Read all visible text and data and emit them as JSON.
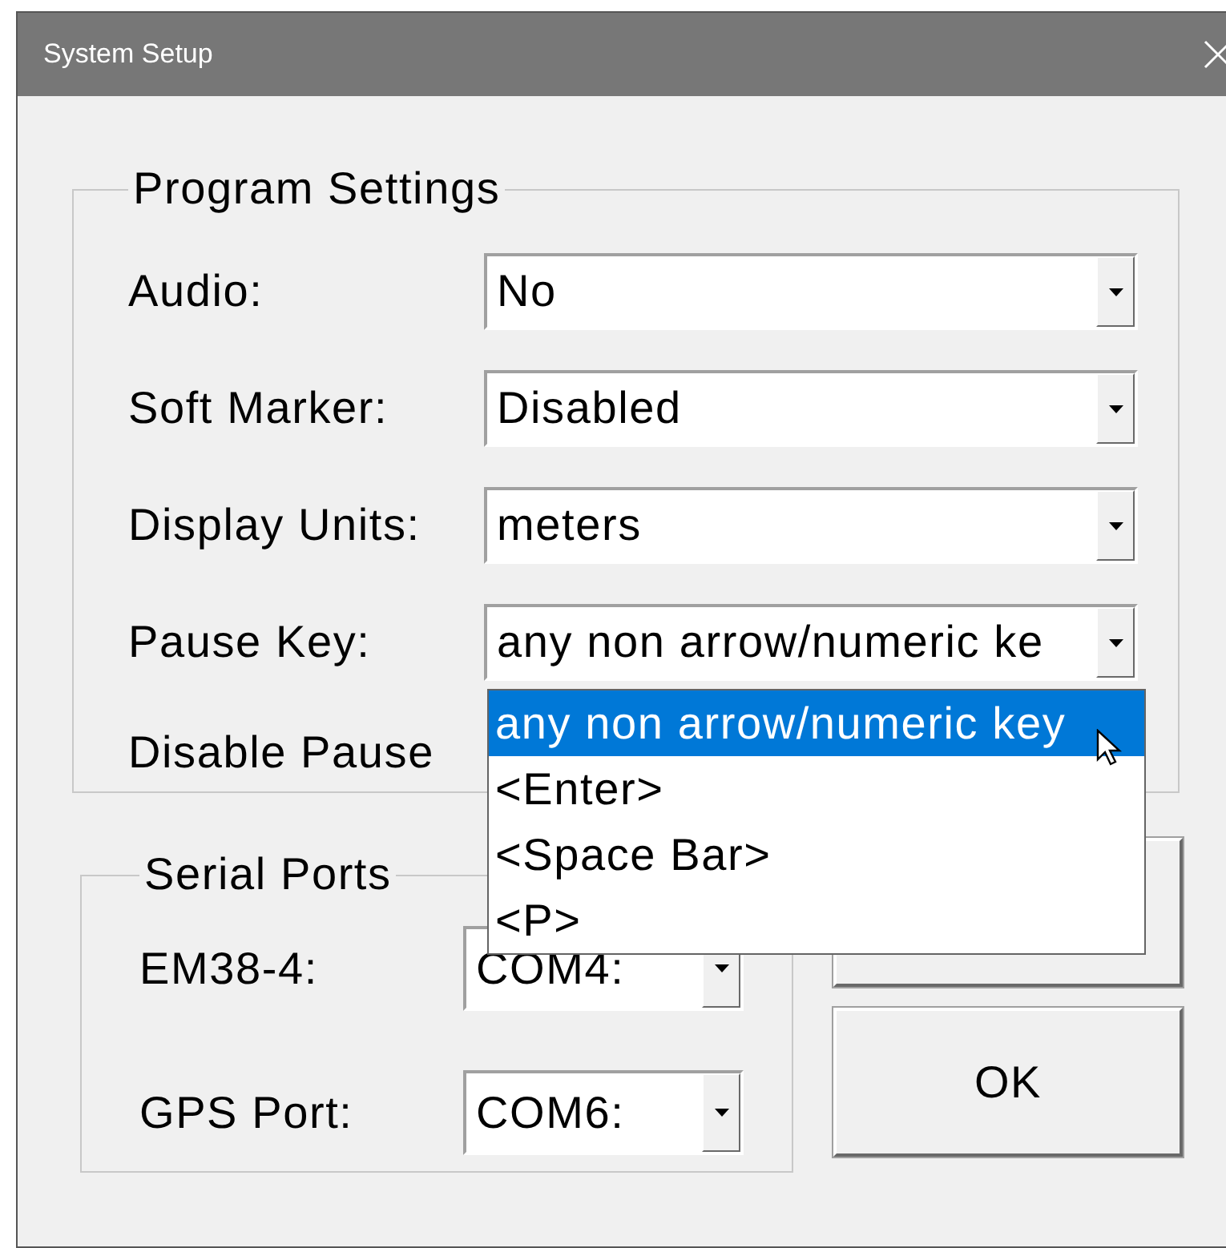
{
  "window": {
    "title": "System Setup"
  },
  "program_settings": {
    "title": "Program Settings",
    "rows": [
      {
        "label": "Audio:",
        "value": "No",
        "expanded": false
      },
      {
        "label": "Soft Marker:",
        "value": "Disabled",
        "expanded": false
      },
      {
        "label": "Display Units:",
        "value": "meters",
        "expanded": false
      },
      {
        "label": "Pause Key:",
        "value": "any non arrow/numeric ke",
        "expanded": true,
        "options": [
          {
            "label": "any non arrow/numeric key",
            "selected": true
          },
          {
            "label": "<Enter>",
            "selected": false
          },
          {
            "label": "<Space Bar>",
            "selected": false
          },
          {
            "label": "<P>",
            "selected": false
          }
        ]
      }
    ],
    "disable_pause": {
      "label": "Disable Pause"
    }
  },
  "serial_ports": {
    "title": "Serial Ports",
    "rows": [
      {
        "label": "EM38-4:",
        "value": "COM4:"
      },
      {
        "label": "GPS Port:",
        "value": "COM6:"
      }
    ]
  },
  "buttons": [
    {
      "kind": "plain"
    },
    {
      "kind": "text",
      "label": "OK"
    }
  ]
}
